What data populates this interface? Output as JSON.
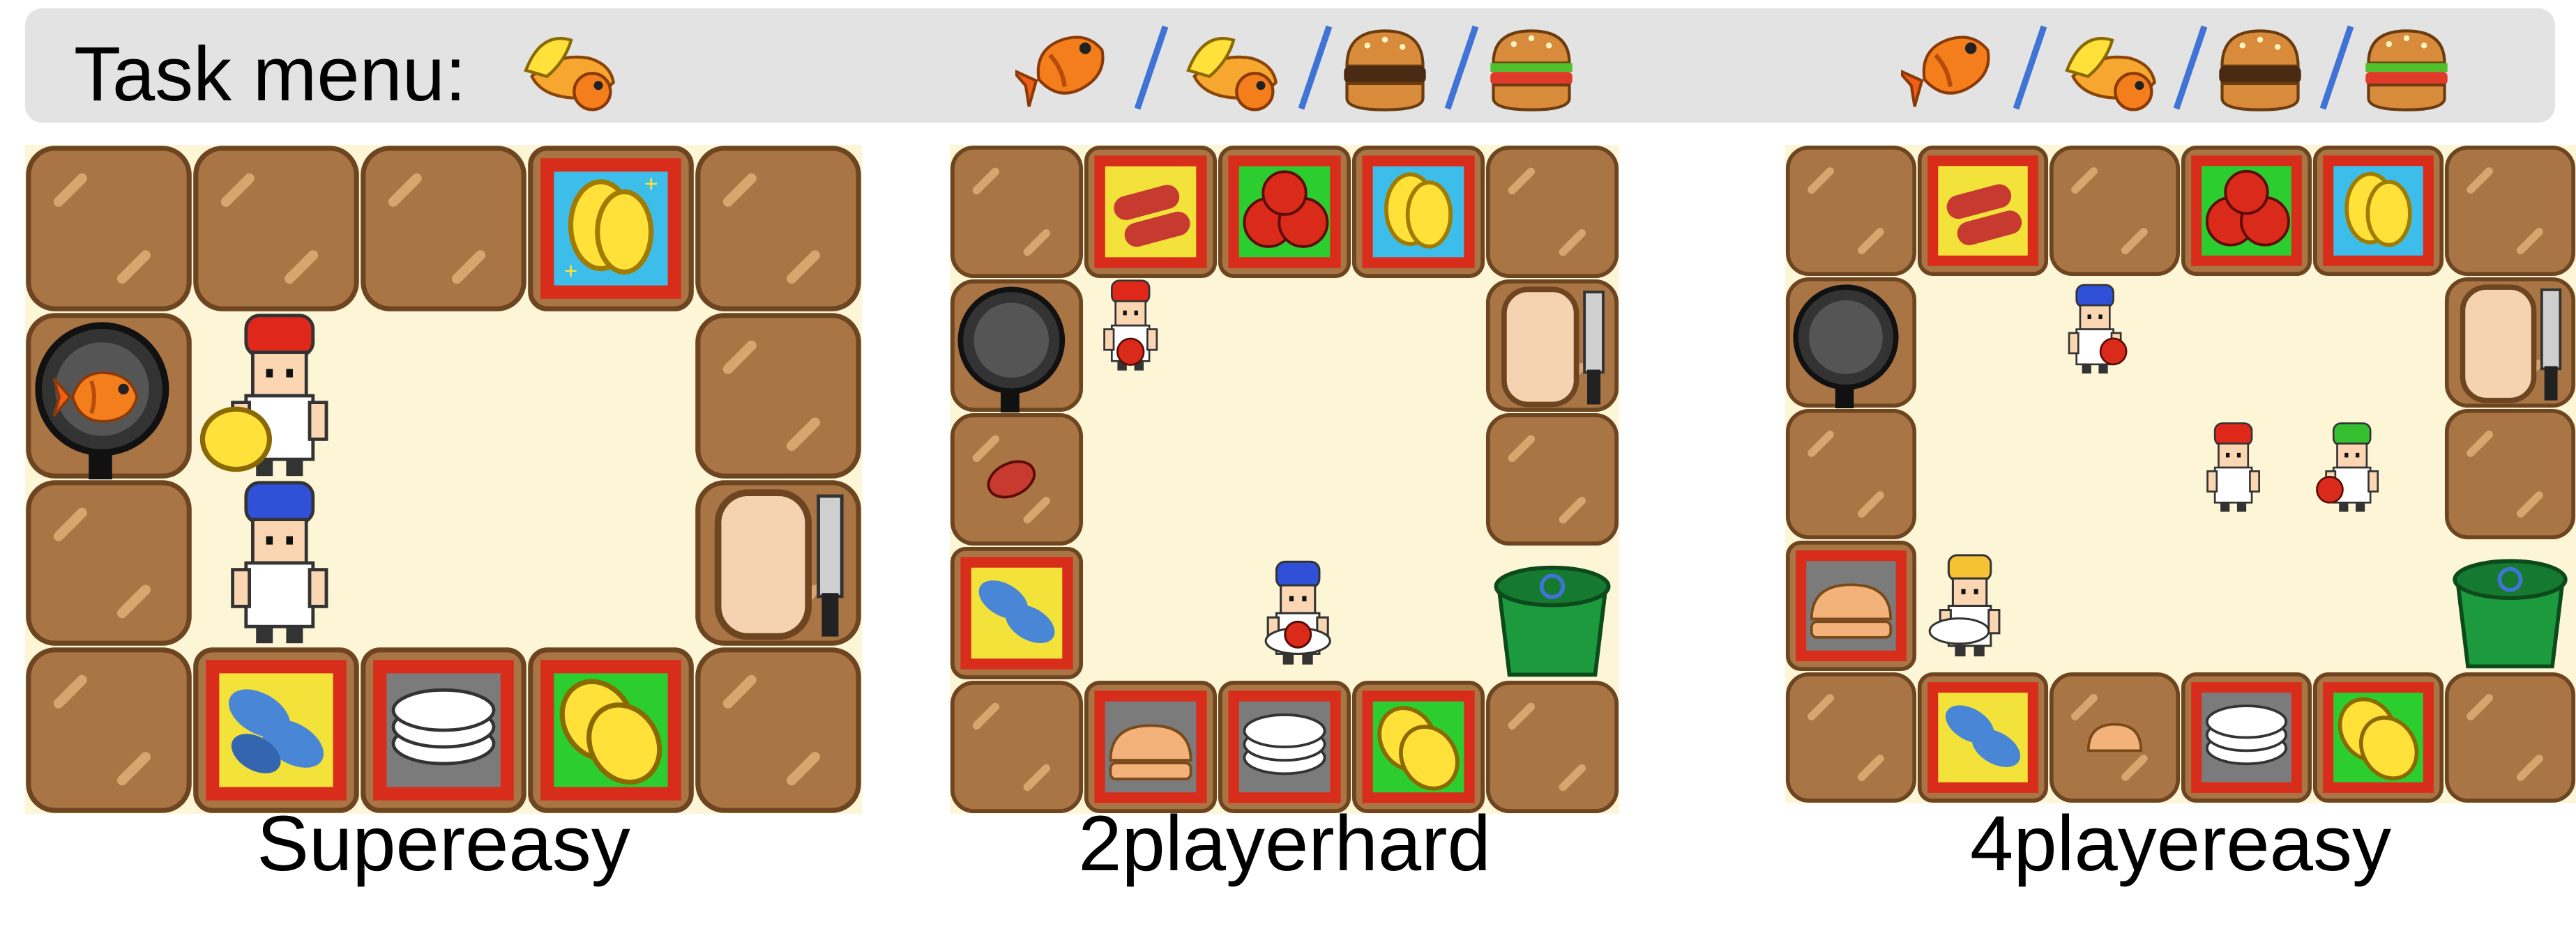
{
  "task_menu": {
    "label": "Task menu:",
    "groups": [
      {
        "name": "supereasy",
        "items": [
          "fish-chips-icon"
        ]
      },
      {
        "name": "2playerhard",
        "items": [
          "fried-fish-icon",
          "fish-chips-icon",
          "burger-icon",
          "burger-lettuce-icon"
        ]
      },
      {
        "name": "4playereasy",
        "items": [
          "fried-fish-icon",
          "fish-chips-icon",
          "burger-icon",
          "burger-lettuce-icon"
        ]
      }
    ]
  },
  "colors": {
    "counter": "#a87543",
    "floor": "#fdf6d6",
    "slash": "#3f73d6",
    "ingredient_border": "#d92d1c",
    "fish_bg": "#f2e23a",
    "plate_bg": "#7b7b7b",
    "lemon_bg": "#2ccd2f",
    "potato_bg": "#3dbdea"
  },
  "levels": [
    {
      "caption": "Supereasy",
      "grid": [
        [
          "counter",
          "counter",
          "counter",
          "potato-crate",
          "counter"
        ],
        [
          "pan-station",
          "floor",
          "floor",
          "floor",
          "counter"
        ],
        [
          "counter",
          "floor",
          "floor",
          "floor",
          "chopping-board"
        ],
        [
          "counter",
          "fish-crate",
          "plate-stack",
          "lemon-crate",
          "counter"
        ]
      ],
      "agents": [
        "red-chef-holding-lemon",
        "blue-chef"
      ]
    },
    {
      "caption": "2playerhard",
      "grid": [
        [
          "counter",
          "sausage-crate",
          "tomato-crate",
          "potato-crate",
          "counter"
        ],
        [
          "pan-station",
          "floor",
          "floor",
          "floor",
          "chopping-board"
        ],
        [
          "counter-with-meat",
          "floor",
          "floor",
          "floor",
          "counter"
        ],
        [
          "fish-crate",
          "floor",
          "floor",
          "floor",
          "trash-bin"
        ],
        [
          "counter",
          "bun-crate",
          "plate-stack",
          "lemon-crate",
          "counter"
        ]
      ],
      "agents": [
        "red-chef-holding-tomato",
        "blue-chef-holding-tomato-plate"
      ]
    },
    {
      "caption": "4playereasy",
      "grid": [
        [
          "counter",
          "sausage-crate",
          "counter",
          "tomato-crate",
          "potato-crate",
          "counter"
        ],
        [
          "pan-station",
          "floor",
          "floor",
          "floor",
          "floor",
          "chopping-board"
        ],
        [
          "counter",
          "floor",
          "floor",
          "floor",
          "floor",
          "counter"
        ],
        [
          "bun-crate",
          "floor",
          "floor",
          "floor",
          "floor",
          "trash-bin"
        ],
        [
          "counter",
          "fish-crate",
          "counter-with-bun",
          "plate-stack",
          "lemon-crate",
          "counter"
        ]
      ],
      "agents": [
        "blue-chef-holding-tomato",
        "red-chef",
        "green-chef-holding-tomato",
        "yellow-chef-holding-plate"
      ]
    }
  ]
}
